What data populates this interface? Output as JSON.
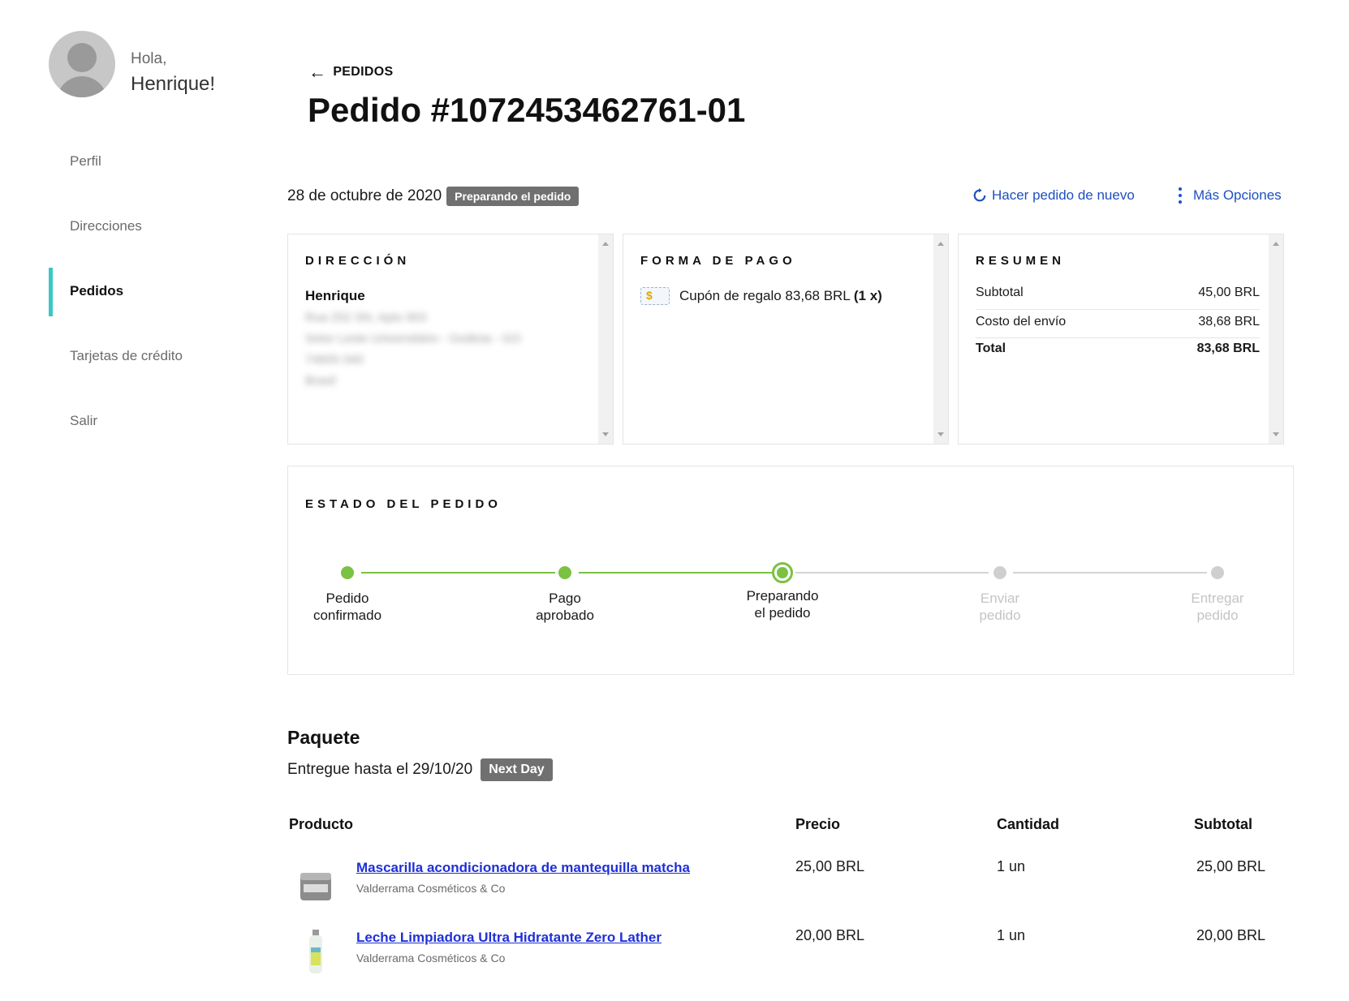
{
  "user": {
    "greeting": "Hola,",
    "name": "Henrique!"
  },
  "sidebar": {
    "items": [
      {
        "label": "Perfil"
      },
      {
        "label": "Direcciones"
      },
      {
        "label": "Pedidos",
        "active": true
      },
      {
        "label": "Tarjetas de crédito"
      },
      {
        "label": "Salir"
      }
    ]
  },
  "header": {
    "back_label": "PEDIDOS",
    "title": "Pedido #1072453462761-01",
    "date": "28 de octubre de 2020",
    "status": "Preparando el pedido",
    "reorder_label": "Hacer pedido de nuevo",
    "more_label": "Más Opciones"
  },
  "address": {
    "title": "DIRECCIÓN",
    "name": "Henrique",
    "lines": [
      "Rua 252 SN, Apto 903",
      "Setor Leste Universitário - Goiânia - GO",
      "74605-340",
      "Brasil"
    ]
  },
  "payment": {
    "title": "FORMA DE PAGO",
    "method": "Cupón de regalo 83,68 BRL",
    "qty": "(1 x)"
  },
  "summary": {
    "title": "RESUMEN",
    "rows": [
      {
        "label": "Subtotal",
        "value": "45,00 BRL"
      },
      {
        "label": "Costo del envío",
        "value": "38,68 BRL"
      },
      {
        "label": "Total",
        "value": "83,68 BRL"
      }
    ]
  },
  "order_status": {
    "title": "ESTADO DEL PEDIDO",
    "steps": [
      {
        "line1": "Pedido",
        "line2": "confirmado",
        "state": "done"
      },
      {
        "line1": "Pago",
        "line2": "aprobado",
        "state": "done"
      },
      {
        "line1": "Preparando",
        "line2": "el pedido",
        "state": "current"
      },
      {
        "line1": "Enviar",
        "line2": "pedido",
        "state": "pending"
      },
      {
        "line1": "Entregar",
        "line2": "pedido",
        "state": "pending"
      }
    ]
  },
  "package": {
    "title": "Paquete",
    "delivery": "Entregue hasta el 29/10/20",
    "badge": "Next Day"
  },
  "products": {
    "headers": {
      "product": "Producto",
      "price": "Precio",
      "qty": "Cantidad",
      "subtotal": "Subtotal"
    },
    "rows": [
      {
        "name": "Mascarilla acondicionadora de mantequilla matcha",
        "brand": "Valderrama Cosméticos & Co",
        "price": "25,00 BRL",
        "qty": "1 un",
        "subtotal": "25,00 BRL"
      },
      {
        "name": "Leche Limpiadora Ultra Hidratante Zero Lather",
        "brand": "Valderrama Cosméticos & Co",
        "price": "20,00 BRL",
        "qty": "1 un",
        "subtotal": "20,00 BRL"
      }
    ]
  },
  "colors": {
    "accent": "#3cc7c5",
    "link": "#1f4fbf",
    "step_done": "#7bc142",
    "step_pending": "#cfcfcf",
    "badge": "#707070"
  }
}
